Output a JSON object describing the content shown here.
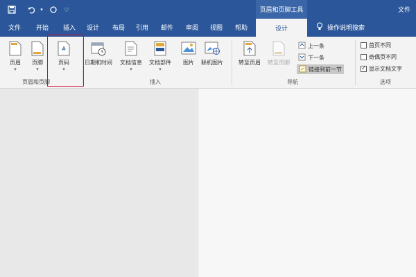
{
  "title_bar": {
    "contextual_header": "页眉和页脚工具",
    "file_label": "文件"
  },
  "tabs": [
    "文件",
    "开始",
    "插入",
    "设计",
    "布局",
    "引用",
    "邮件",
    "审阅",
    "视图",
    "帮助"
  ],
  "active_tab": "设计",
  "tell_me": "操作说明搜索",
  "ribbon": {
    "header_footer_group": {
      "label": "页眉和页脚",
      "header": "页眉",
      "footer": "页脚",
      "page_number": "页码",
      "page_number_icon_text": "#"
    },
    "insert_group": {
      "label": "插入",
      "date_time": "日期和时间",
      "doc_info": "文档信息",
      "doc_parts": "文档部件",
      "picture": "图片",
      "online_picture": "联机图片"
    },
    "nav_group": {
      "label": "导航",
      "goto_header": "转至页眉",
      "goto_footer": "转至页脚",
      "previous": "上一条",
      "next": "下一条",
      "link_previous": "链接到前一节"
    },
    "options_group": {
      "label": "选项",
      "first_page_diff": "首页不同",
      "odd_even_diff": "奇偶页不同",
      "show_doc_text": "显示文档文字",
      "first_page_diff_checked": false,
      "odd_even_diff_checked": false,
      "show_doc_text_checked": true
    }
  },
  "colors": {
    "accent": "#2b579a",
    "highlight_box": "#c8102e"
  }
}
